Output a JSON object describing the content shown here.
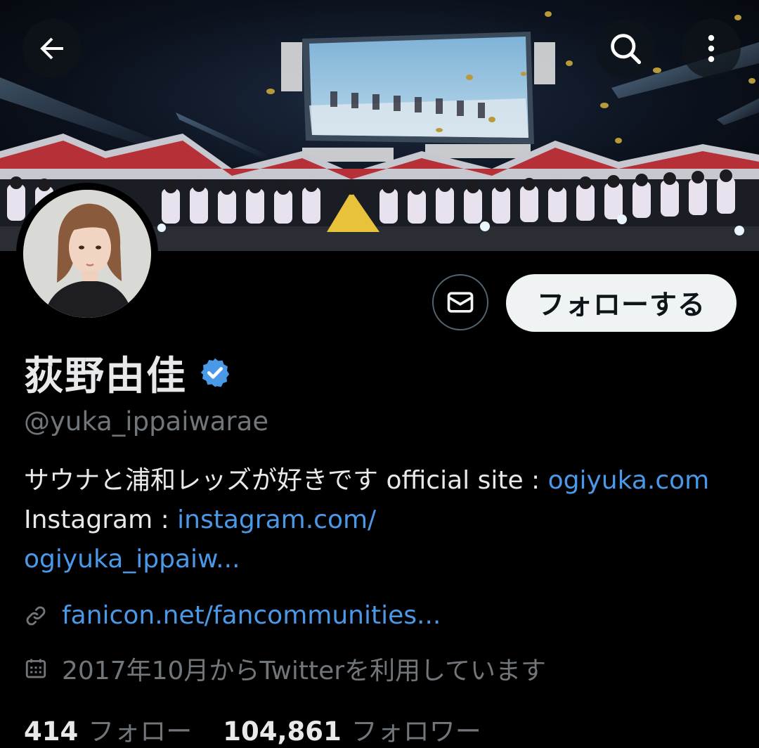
{
  "header": {
    "back_icon": "arrow-left-icon",
    "search_icon": "search-icon",
    "more_icon": "more-vertical-icon"
  },
  "banner": {
    "description_icon": "concert-stage-banner"
  },
  "actions": {
    "dm_icon": "envelope-icon",
    "follow_label": "フォローする"
  },
  "profile": {
    "display_name": "荻野由佳",
    "verified_icon": "verified-badge-icon",
    "verified_color": "#4a99e9",
    "handle": "@yuka_ippaiwarae",
    "bio": {
      "text_1": "サウナと浦和レッズが好きです official site : ",
      "link_1": "ogiyuka.com",
      "text_2": " Instagram : ",
      "link_2a": "instagram.com/",
      "link_2b": "ogiyuka_ippaiw..."
    },
    "website": "fanicon.net/fancommunities...",
    "joined": "2017年10月からTwitterを利用しています"
  },
  "stats": {
    "following_count": "414",
    "following_label": "フォロー",
    "followers_count": "104,861",
    "followers_label": "フォロワー"
  },
  "colors": {
    "background": "#000000",
    "text_primary": "#e7e9ea",
    "text_secondary": "#71767b",
    "link": "#4a99e9",
    "follow_button_bg": "#eff3f4"
  }
}
